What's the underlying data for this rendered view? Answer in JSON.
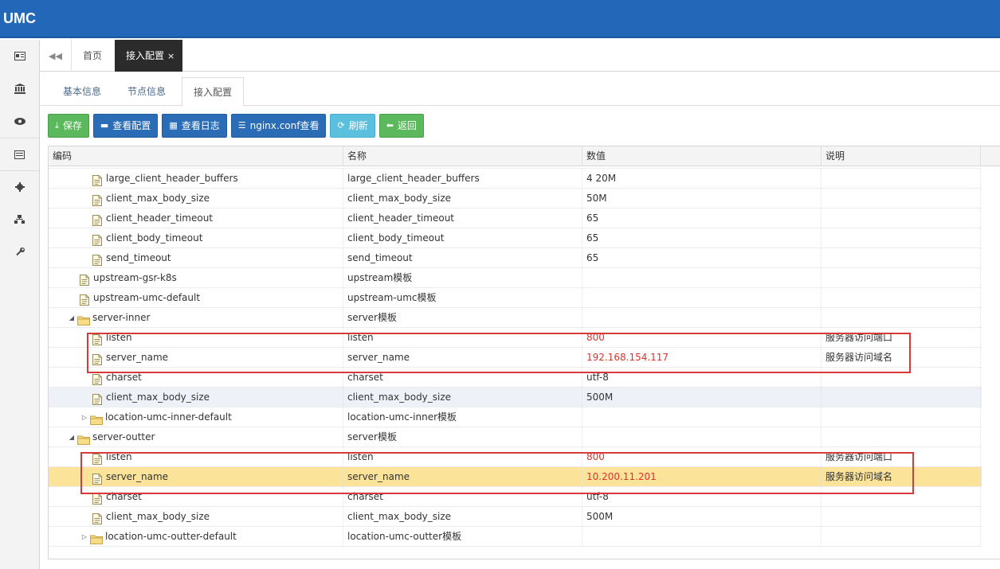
{
  "app": {
    "title": "UMC"
  },
  "tabs": {
    "back": "◀◀",
    "home": "首页",
    "active": "接入配置",
    "close": "×"
  },
  "subtabs": [
    "基本信息",
    "节点信息",
    "接入配置"
  ],
  "toolbar": {
    "save": "保存",
    "view_config": "查看配置",
    "view_log": "查看日志",
    "nginx_view": "nginx.conf查看",
    "refresh": "刷新",
    "back": "返回"
  },
  "grid": {
    "columns": [
      "编码",
      "名称",
      "数值",
      "说明"
    ],
    "rows": [
      {
        "code": "large_client_header_buffers",
        "name": "large_client_header_buffers",
        "value": "4 20M",
        "desc": ""
      },
      {
        "code": "client_max_body_size",
        "name": "client_max_body_size",
        "value": "50M",
        "desc": ""
      },
      {
        "code": "client_header_timeout",
        "name": "client_header_timeout",
        "value": "65",
        "desc": ""
      },
      {
        "code": "client_body_timeout",
        "name": "client_body_timeout",
        "value": "65",
        "desc": ""
      },
      {
        "code": "send_timeout",
        "name": "send_timeout",
        "value": "65",
        "desc": ""
      },
      {
        "code": "upstream-gsr-k8s",
        "name": "upstream模板",
        "value": "",
        "desc": ""
      },
      {
        "code": "upstream-umc-default",
        "name": "upstream-umc模板",
        "value": "",
        "desc": ""
      },
      {
        "code": "server-inner",
        "name": "server模板",
        "value": "",
        "desc": ""
      },
      {
        "code": "listen",
        "name": "listen",
        "value": "800",
        "desc": "服务器访问端口"
      },
      {
        "code": "server_name",
        "name": "server_name",
        "value": "192.168.154.117",
        "desc": "服务器访问域名"
      },
      {
        "code": "charset",
        "name": "charset",
        "value": "utf-8",
        "desc": ""
      },
      {
        "code": "client_max_body_size",
        "name": "client_max_body_size",
        "value": "500M",
        "desc": ""
      },
      {
        "code": "location-umc-inner-default",
        "name": "location-umc-inner模板",
        "value": "",
        "desc": ""
      },
      {
        "code": "server-outter",
        "name": "server模板",
        "value": "",
        "desc": ""
      },
      {
        "code": "listen",
        "name": "listen",
        "value": "800",
        "desc": "服务器访问端口"
      },
      {
        "code": "server_name",
        "name": "server_name",
        "value": "10.200.11.201",
        "desc": "服务器访问域名"
      },
      {
        "code": "charset",
        "name": "charset",
        "value": "utf-8",
        "desc": ""
      },
      {
        "code": "client_max_body_size",
        "name": "client_max_body_size",
        "value": "500M",
        "desc": ""
      },
      {
        "code": "location-umc-outter-default",
        "name": "location-umc-outter模板",
        "value": "",
        "desc": ""
      }
    ]
  },
  "colors": {
    "header": "#2368b8",
    "highlight_box": "#d83a3a",
    "selected_row": "#fbe39a",
    "value_red": "#d9342b"
  }
}
